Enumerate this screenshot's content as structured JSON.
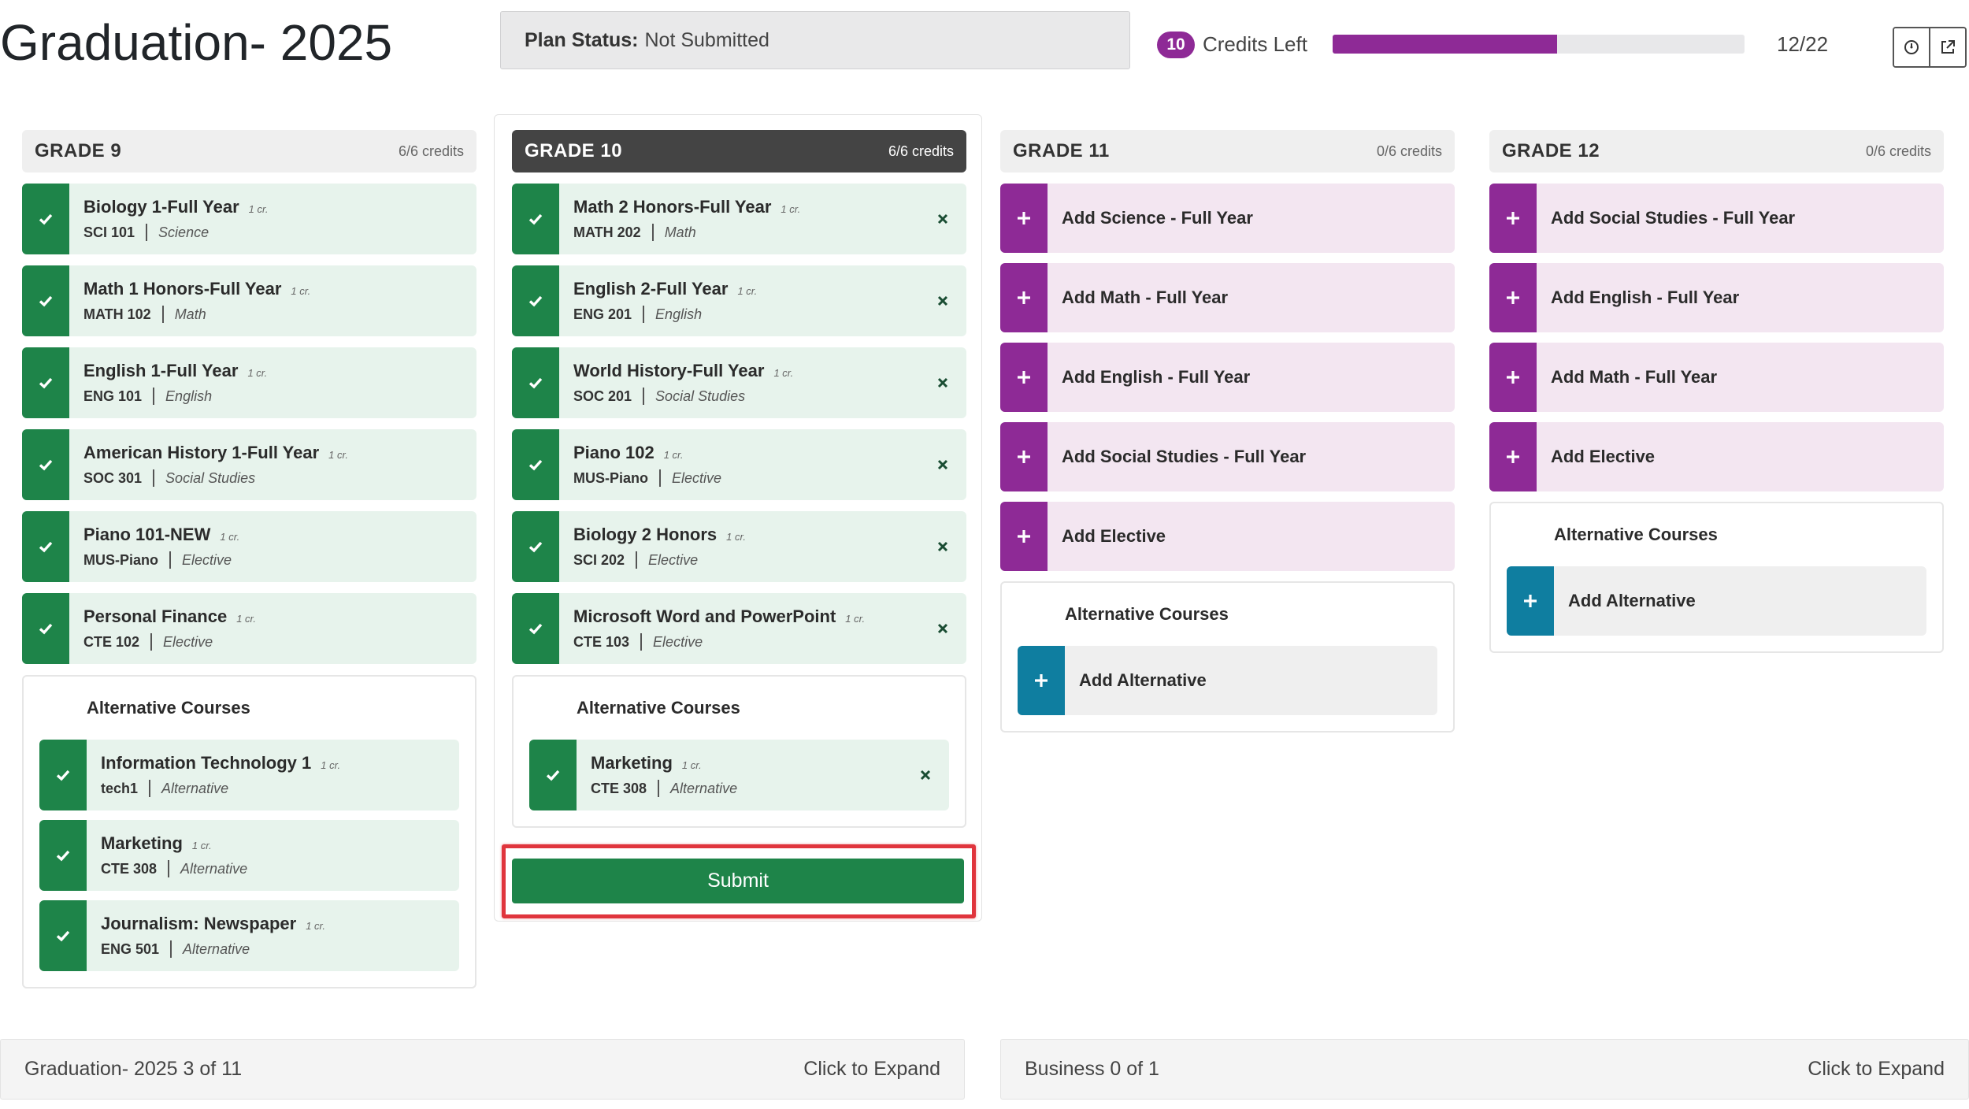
{
  "header": {
    "title": "Graduation- 2025",
    "plan_status_label": "Plan Status:",
    "plan_status_value": "Not Submitted",
    "credits_left_count": "10",
    "credits_left_label": "Credits Left",
    "progress_text": "12/22",
    "progress_fraction": 0.545,
    "accent_color": "#8e2a96",
    "icons": [
      "clock-icon",
      "external-link-icon"
    ]
  },
  "grades": {
    "g9": {
      "title": "GRADE 9",
      "credits": "6/6 credits",
      "courses": [
        {
          "name": "Biology 1-Full Year",
          "credit": "1 cr.",
          "code": "SCI 101",
          "type": "Science"
        },
        {
          "name": "Math 1 Honors-Full Year",
          "credit": "1 cr.",
          "code": "MATH 102",
          "type": "Math"
        },
        {
          "name": "English 1-Full Year",
          "credit": "1 cr.",
          "code": "ENG 101",
          "type": "English"
        },
        {
          "name": "American History 1-Full Year",
          "credit": "1 cr.",
          "code": "SOC 301",
          "type": "Social Studies"
        },
        {
          "name": "Piano 101-NEW",
          "credit": "1 cr.",
          "code": "MUS-Piano",
          "type": "Elective"
        },
        {
          "name": "Personal Finance",
          "credit": "1 cr.",
          "code": "CTE 102",
          "type": "Elective"
        }
      ],
      "alt_title": "Alternative Courses",
      "alternatives": [
        {
          "name": "Information Technology 1",
          "credit": "1 cr.",
          "code": "tech1",
          "type": "Alternative"
        },
        {
          "name": "Marketing",
          "credit": "1 cr.",
          "code": "CTE 308",
          "type": "Alternative"
        },
        {
          "name": "Journalism: Newspaper",
          "credit": "1 cr.",
          "code": "ENG 501",
          "type": "Alternative"
        }
      ]
    },
    "g10": {
      "title": "GRADE 10",
      "credits": "6/6 credits",
      "courses": [
        {
          "name": "Math 2 Honors-Full Year",
          "credit": "1 cr.",
          "code": "MATH 202",
          "type": "Math"
        },
        {
          "name": "English 2-Full Year",
          "credit": "1 cr.",
          "code": "ENG 201",
          "type": "English"
        },
        {
          "name": "World History-Full Year",
          "credit": "1 cr.",
          "code": "SOC 201",
          "type": "Social Studies"
        },
        {
          "name": "Piano 102",
          "credit": "1 cr.",
          "code": "MUS-Piano",
          "type": "Elective"
        },
        {
          "name": "Biology 2 Honors",
          "credit": "1 cr.",
          "code": "SCI 202",
          "type": "Elective"
        },
        {
          "name": "Microsoft Word and PowerPoint",
          "credit": "1 cr.",
          "code": "CTE 103",
          "type": "Elective"
        }
      ],
      "alt_title": "Alternative Courses",
      "alternatives": [
        {
          "name": "Marketing",
          "credit": "1 cr.",
          "code": "CTE 308",
          "type": "Alternative"
        }
      ],
      "submit_label": "Submit"
    },
    "g11": {
      "title": "GRADE 11",
      "credits": "0/6 credits",
      "add_items": [
        "Add Science - Full Year",
        "Add Math - Full Year",
        "Add English - Full Year",
        "Add Social Studies - Full Year",
        "Add Elective"
      ],
      "alt_title": "Alternative Courses",
      "alt_add_label": "Add Alternative"
    },
    "g12": {
      "title": "GRADE 12",
      "credits": "0/6 credits",
      "add_items": [
        "Add Social Studies - Full Year",
        "Add English - Full Year",
        "Add Math - Full Year",
        "Add Elective"
      ],
      "alt_title": "Alternative Courses",
      "alt_add_label": "Add Alternative"
    }
  },
  "footer": {
    "left_label": "Graduation- 2025 3 of 11",
    "left_action": "Click to Expand",
    "right_label": "Business 0 of 1",
    "right_action": "Click to Expand"
  },
  "colors": {
    "completed": "#1e8449",
    "completed_bg": "#e7f3ec",
    "add": "#8e2a96",
    "add_bg": "#f3e6f1",
    "alternative": "#0f7ea0",
    "highlight": "#e0353d"
  }
}
